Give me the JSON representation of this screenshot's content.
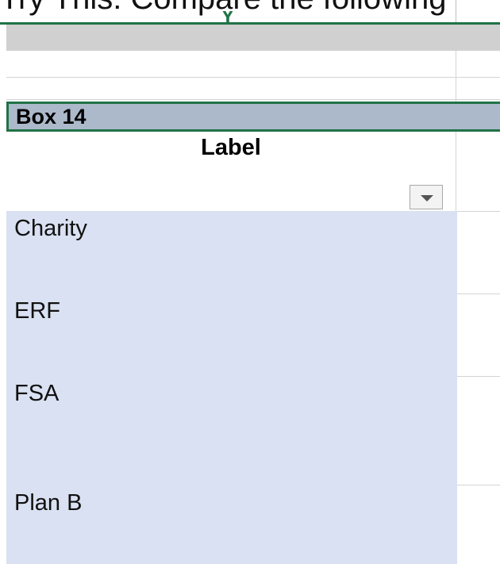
{
  "sheet": {
    "column_header": {
      "letter": "Y"
    },
    "intro_text": "Try This: Compare the following",
    "box14_title": "Box 14",
    "label_header": "Label",
    "filter_icon": "dropdown-filter-icon",
    "items": [
      "Charity",
      "ERF",
      "FSA",
      "Plan B"
    ]
  },
  "colors": {
    "excel_green": "#217346",
    "selected_header_bg": "#acb9ca",
    "data_fill": "#d9e1f2",
    "gray_band": "#d0d0d0"
  }
}
